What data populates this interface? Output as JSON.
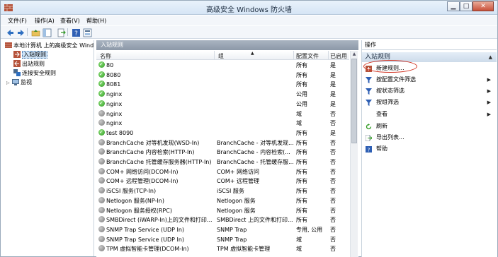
{
  "window": {
    "title": "高级安全 Windows 防火墙",
    "min_glyph": "▁",
    "max_glyph": "□",
    "close_glyph": "✕"
  },
  "menu": [
    "文件(F)",
    "操作(A)",
    "查看(V)",
    "帮助(H)"
  ],
  "tree": {
    "root": "本地计算机 上的高级安全 Windows...",
    "items": [
      "入站规则",
      "出站规则",
      "连接安全规则",
      "监视"
    ]
  },
  "center": {
    "pane_title": "入站规则",
    "columns": {
      "name": "名称",
      "group": "组",
      "profile": "配置文件",
      "enabled": "已启用"
    },
    "rows": [
      {
        "name": "80",
        "group": "",
        "profile": "所有",
        "enabled": "是",
        "on": true
      },
      {
        "name": "8080",
        "group": "",
        "profile": "所有",
        "enabled": "是",
        "on": true
      },
      {
        "name": "8081",
        "group": "",
        "profile": "所有",
        "enabled": "是",
        "on": true
      },
      {
        "name": "nginx",
        "group": "",
        "profile": "公用",
        "enabled": "是",
        "on": true
      },
      {
        "name": "nginx",
        "group": "",
        "profile": "公用",
        "enabled": "是",
        "on": true
      },
      {
        "name": "nginx",
        "group": "",
        "profile": "域",
        "enabled": "否",
        "on": false
      },
      {
        "name": "nginx",
        "group": "",
        "profile": "域",
        "enabled": "否",
        "on": false
      },
      {
        "name": "test 8090",
        "group": "",
        "profile": "所有",
        "enabled": "是",
        "on": true
      },
      {
        "name": "BranchCache 对等机发现(WSD-In)",
        "group": "BranchCache - 对等机发现...",
        "profile": "所有",
        "enabled": "否",
        "on": false
      },
      {
        "name": "BranchCache 内容检索(HTTP-In)",
        "group": "BranchCache - 内容检索(...",
        "profile": "所有",
        "enabled": "否",
        "on": false
      },
      {
        "name": "BranchCache 托管缓存服务器(HTTP-In)",
        "group": "BranchCache - 托管缓存服...",
        "profile": "所有",
        "enabled": "否",
        "on": false
      },
      {
        "name": "COM+ 网络访问(DCOM-In)",
        "group": "COM+ 网络访问",
        "profile": "所有",
        "enabled": "否",
        "on": false
      },
      {
        "name": "COM+ 远程管理(DCOM-In)",
        "group": "COM+ 远程管理",
        "profile": "所有",
        "enabled": "否",
        "on": false
      },
      {
        "name": "iSCSI 服务(TCP-In)",
        "group": "iSCSI 服务",
        "profile": "所有",
        "enabled": "否",
        "on": false
      },
      {
        "name": "Netlogon 服务(NP-In)",
        "group": "Netlogon 服务",
        "profile": "所有",
        "enabled": "否",
        "on": false
      },
      {
        "name": "Netlogon 服务授权(RPC)",
        "group": "Netlogon 服务",
        "profile": "所有",
        "enabled": "否",
        "on": false
      },
      {
        "name": "SMBDirect (iWARP-In)上的文件和打印...",
        "group": "SMBDirect 上的文件和打印...",
        "profile": "所有",
        "enabled": "否",
        "on": false
      },
      {
        "name": "SNMP Trap Service (UDP In)",
        "group": "SNMP Trap",
        "profile": "专用, 公用",
        "enabled": "否",
        "on": false
      },
      {
        "name": "SNMP Trap Service (UDP In)",
        "group": "SNMP Trap",
        "profile": "域",
        "enabled": "否",
        "on": false
      },
      {
        "name": "TPM 虚拟智能卡管理(DCOM-In)",
        "group": "TPM 虚拟智能卡管理",
        "profile": "域",
        "enabled": "否",
        "on": false
      }
    ]
  },
  "actions": {
    "header": "操作",
    "section": "入站规则",
    "items": [
      {
        "label": "新建规则...",
        "icon": "new-rule-icon",
        "submenu": false
      },
      {
        "label": "按配置文件筛选",
        "icon": "filter-icon",
        "submenu": true
      },
      {
        "label": "按状态筛选",
        "icon": "filter-icon",
        "submenu": true
      },
      {
        "label": "按组筛选",
        "icon": "filter-icon",
        "submenu": true
      },
      {
        "label": "查看",
        "icon": "view-icon",
        "submenu": true
      },
      {
        "label": "刷新",
        "icon": "refresh-icon",
        "submenu": false
      },
      {
        "label": "导出列表...",
        "icon": "export-icon",
        "submenu": false
      },
      {
        "label": "帮助",
        "icon": "help-icon",
        "submenu": false
      }
    ]
  },
  "colors": {
    "enabled_dot": "#2f9a22",
    "disabled_dot": "#7a7a7a",
    "highlight": "#d23a2a"
  }
}
